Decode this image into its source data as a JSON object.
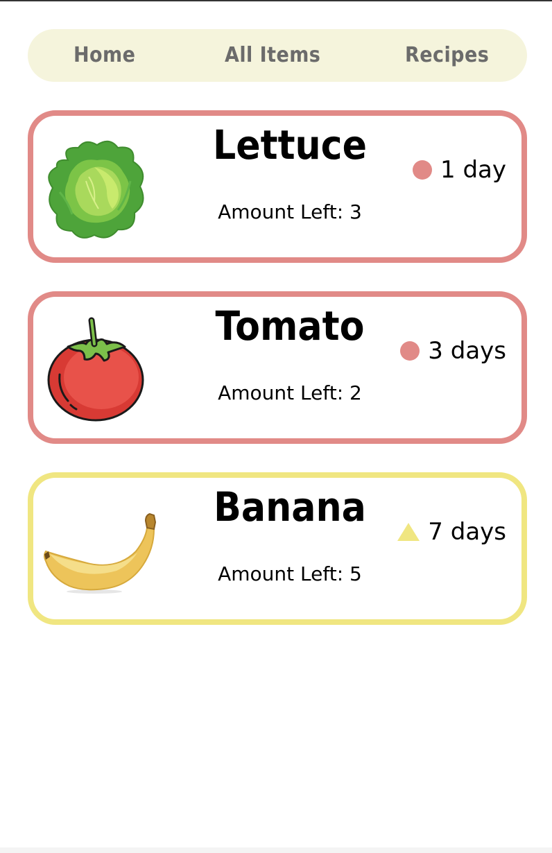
{
  "nav": {
    "items": [
      {
        "label": "Home"
      },
      {
        "label": "All Items"
      },
      {
        "label": "Recipes"
      }
    ]
  },
  "colors": {
    "urgent": "#e18a87",
    "soon": "#f0e681",
    "nav_bg": "#f5f4dc"
  },
  "items": [
    {
      "name": "Lettuce",
      "amount": "Amount Left: 3",
      "expires": "1 day",
      "status_icon": "circle-icon",
      "status_color": "#e18a87",
      "image": "lettuce-icon"
    },
    {
      "name": "Tomato",
      "amount": "Amount Left: 2",
      "expires": "3 days",
      "status_icon": "circle-icon",
      "status_color": "#e18a87",
      "image": "tomato-icon"
    },
    {
      "name": "Banana",
      "amount": "Amount Left: 5",
      "expires": "7 days",
      "status_icon": "triangle-icon",
      "status_color": "#f0e681",
      "image": "banana-icon"
    }
  ]
}
